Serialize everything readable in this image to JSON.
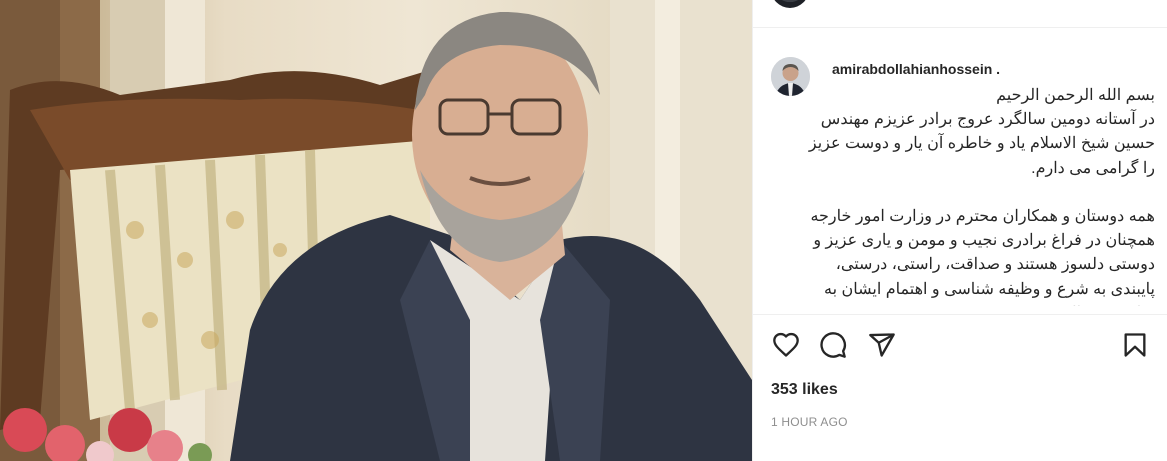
{
  "post": {
    "username": "amirabdollahianhossein",
    "username_suffix": ".",
    "caption": "بسم الله الرحمن الرحیم\nدر آستانه دومین سالگرد عروج برادر عزیزم مهندس حسین شیخ الاسلام یاد و خاطره آن یار و دوست عزیز را گرامی می دارم.\n\nهمه دوستان و همکاران محترم در وزارت امور خارجه همچنان در فراغ برادری نجیب و مومن و یاری عزیز و دوستی دلسوز هستند و صداقت، راستی، درستی، پایبندی به شرع و وظیفه شناسی و اهتمام ایشان به منافع و مصالح",
    "likes": "353 likes",
    "timestamp": "1 HOUR AGO"
  },
  "icons": {
    "like": "heart-icon",
    "comment": "comment-bubble-icon",
    "share": "paper-plane-icon",
    "save": "bookmark-icon"
  },
  "colors": {
    "text": "#262626",
    "muted": "#8e8e8e",
    "divider": "#efefef"
  }
}
